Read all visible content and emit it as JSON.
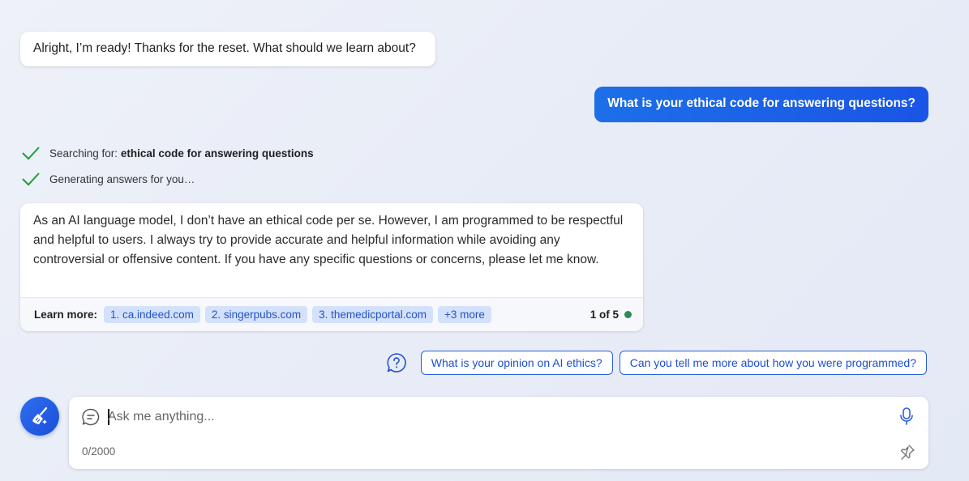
{
  "conversation": {
    "greeting": "Alright, I’m ready! Thanks for the reset. What should we learn about?",
    "user_message": "What is your ethical code for answering questions?",
    "status": {
      "searching_prefix": "Searching for: ",
      "searching_query": "ethical code for answering questions",
      "generating": "Generating answers for you…"
    },
    "answer": {
      "text": "As an AI language model, I don’t have an ethical code per se. However, I am programmed to be respectful and helpful to users. I always try to provide accurate and helpful information while avoiding any controversial or offensive content. If you have any specific questions or concerns, please let me know.",
      "learn_more_label": "Learn more:",
      "sources": [
        "1. ca.indeed.com",
        "2. singerpubs.com",
        "3. themedicportal.com",
        "+3 more"
      ],
      "page_indicator": "1 of 5"
    }
  },
  "suggestions": [
    "What is your opinion on AI ethics?",
    "Can you tell me more about how you were programmed?"
  ],
  "input": {
    "placeholder": "Ask me anything...",
    "value": "",
    "char_counter": "0/2000"
  },
  "icons": {
    "check": "checkmark-icon",
    "help": "question-bubble-icon",
    "new_topic": "broom-icon",
    "chat": "chat-bubble-icon",
    "mic": "microphone-icon",
    "pin": "pin-icon"
  },
  "colors": {
    "accent": "#1a55e6",
    "check_green": "#1f9d3a",
    "chip_bg": "#d4e1fb",
    "chip_text": "#2253c8",
    "status_dot": "#2e8b57"
  }
}
